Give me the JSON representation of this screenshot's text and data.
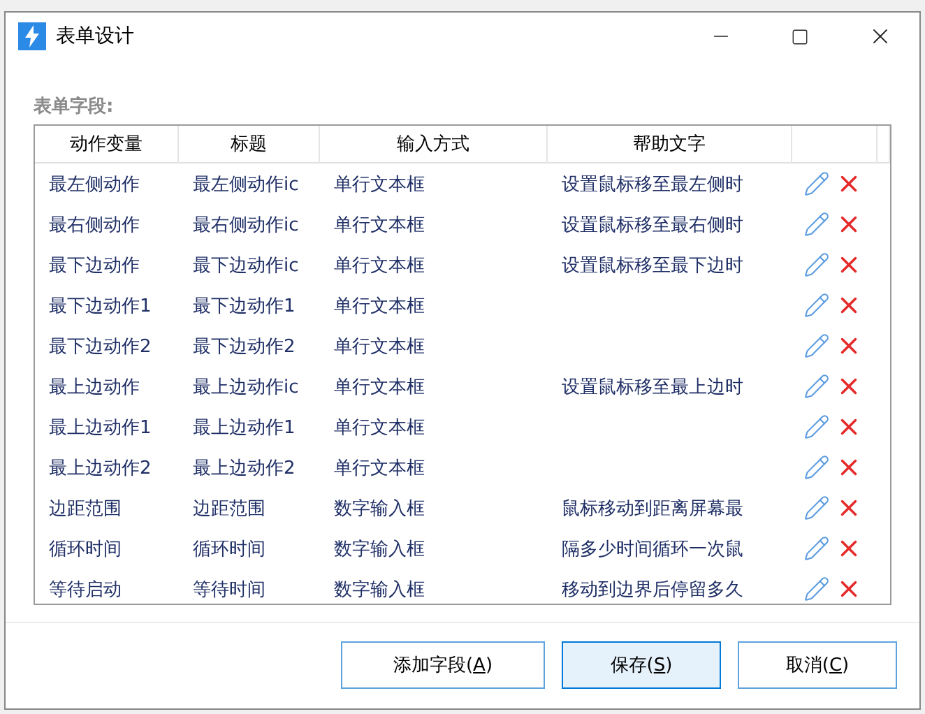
{
  "window": {
    "title": "表单设计"
  },
  "section_label": "表单字段:",
  "table": {
    "columns": [
      "动作变量",
      "标题",
      "输入方式",
      "帮助文字"
    ],
    "rows": [
      {
        "variable": "最左侧动作",
        "title": "最左侧动作ic",
        "input": "单行文本框",
        "help": "设置鼠标移至最左侧时"
      },
      {
        "variable": "最右侧动作",
        "title": "最右侧动作ic",
        "input": "单行文本框",
        "help": "设置鼠标移至最右侧时"
      },
      {
        "variable": "最下边动作",
        "title": "最下边动作ic",
        "input": "单行文本框",
        "help": "设置鼠标移至最下边时"
      },
      {
        "variable": "最下边动作1",
        "title": "最下边动作1",
        "input": "单行文本框",
        "help": ""
      },
      {
        "variable": "最下边动作2",
        "title": "最下边动作2",
        "input": "单行文本框",
        "help": ""
      },
      {
        "variable": "最上边动作",
        "title": "最上边动作ic",
        "input": "单行文本框",
        "help": "设置鼠标移至最上边时"
      },
      {
        "variable": "最上边动作1",
        "title": "最上边动作1",
        "input": "单行文本框",
        "help": ""
      },
      {
        "variable": "最上边动作2",
        "title": "最上边动作2",
        "input": "单行文本框",
        "help": ""
      },
      {
        "variable": "边距范围",
        "title": "边距范围",
        "input": "数字输入框",
        "help": "鼠标移动到距离屏幕最"
      },
      {
        "variable": "循环时间",
        "title": "循环时间",
        "input": "数字输入框",
        "help": "隔多少时间循环一次鼠"
      },
      {
        "variable": "等待启动",
        "title": "等待时间",
        "input": "数字输入框",
        "help": "移动到边界后停留多久"
      }
    ]
  },
  "buttons": [
    {
      "before": "添加字段(",
      "key": "A",
      "after": ")",
      "selected": false
    },
    {
      "before": "保存(",
      "key": "S",
      "after": ")",
      "selected": true
    },
    {
      "before": "取消(",
      "key": "C",
      "after": ")",
      "selected": false
    }
  ]
}
